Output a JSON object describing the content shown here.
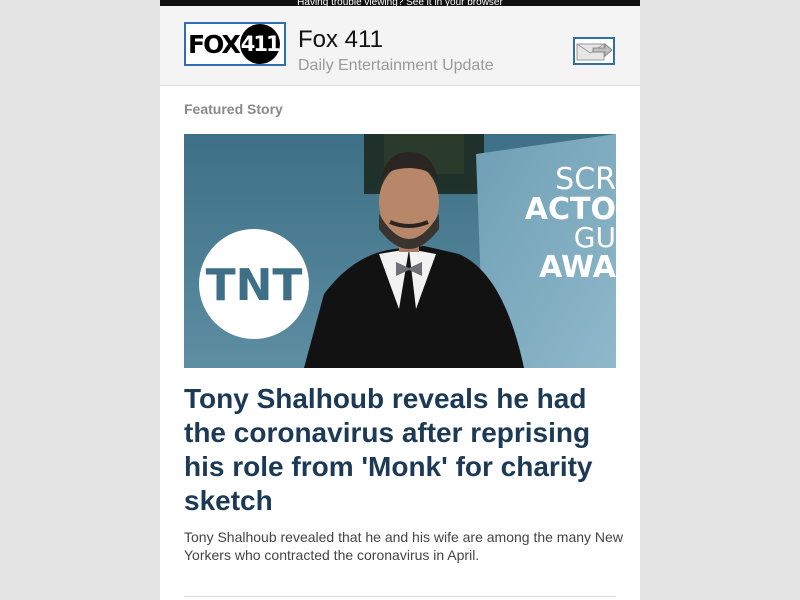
{
  "topbar": {
    "text": "Having trouble viewing? See it in your browser"
  },
  "header": {
    "logo": {
      "text_left": "FOX",
      "text_right": "411"
    },
    "title": "Fox 411",
    "subtitle": "Daily Entertainment Update",
    "share_icon": "envelope-forward-icon"
  },
  "featured": {
    "label": "Featured Story",
    "image": {
      "logo_text": "TNT",
      "sign_lines": [
        "SCR",
        "ACTO",
        "GU",
        "AWA"
      ]
    },
    "headline": "Tony Shalhoub reveals he had the coronavirus after reprising his role from 'Monk' for charity sketch",
    "summary": "Tony Shalhoub revealed that he and his wife are among the many New Yorkers who contracted the coronavirus in April."
  },
  "colors": {
    "background": "#e5e5e5",
    "header_bg": "#f4f4f4",
    "headline": "#1c3a55",
    "accent_border": "#2f6fae"
  }
}
